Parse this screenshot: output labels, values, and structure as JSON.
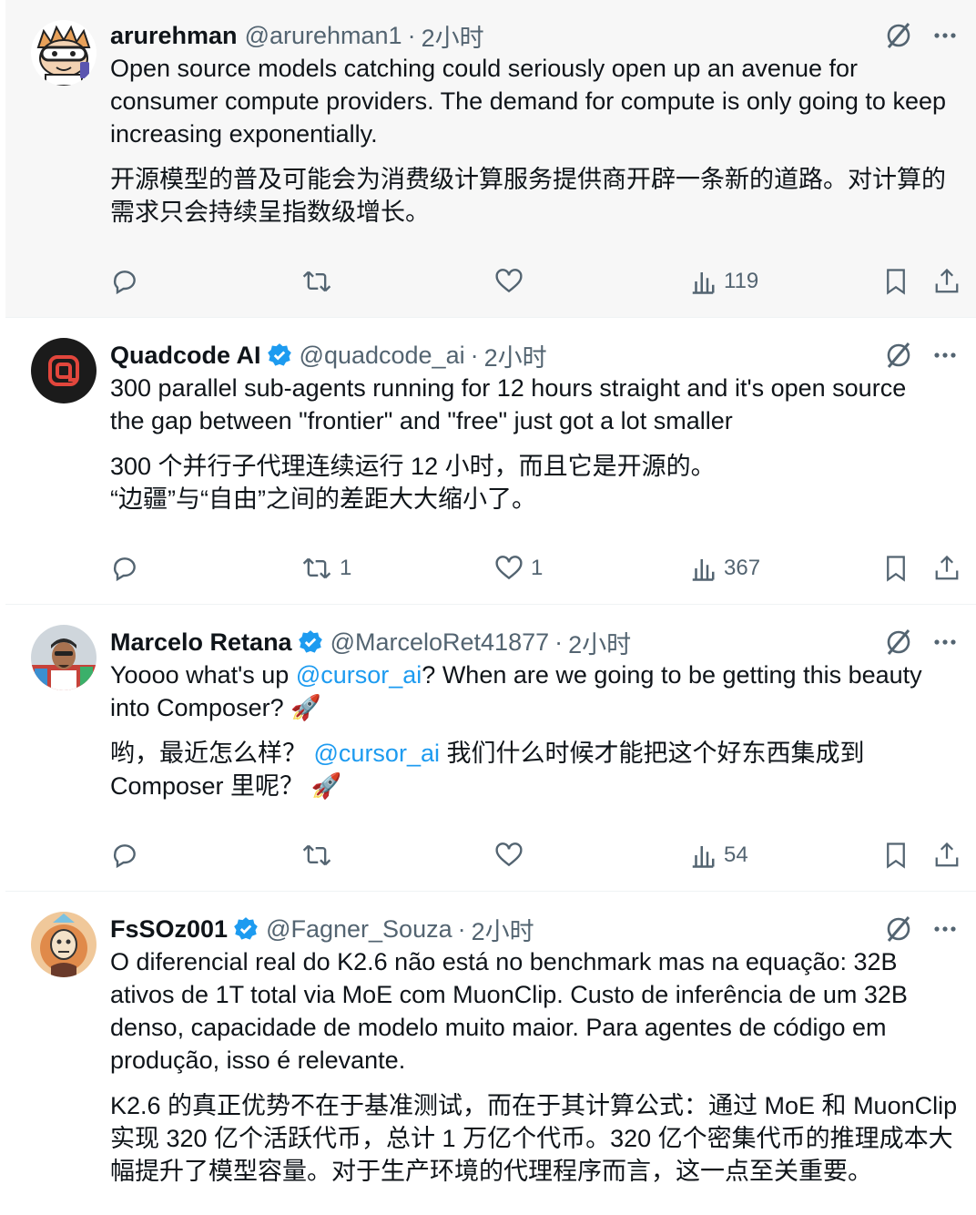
{
  "time_label": "2小时",
  "tweets": [
    {
      "name": "arurehman",
      "handle": "@arurehman1",
      "verified": false,
      "text": "Open source models catching could seriously open up an avenue for consumer compute providers. The demand for compute is only going to keep increasing exponentially.",
      "translation": "开源模型的普及可能会为消费级计算服务提供商开辟一条新的道路。对计算的需求只会持续呈指数级增长。",
      "replies": "",
      "retweets": "",
      "likes": "",
      "views": "119"
    },
    {
      "name": "Quadcode AI",
      "handle": "@quadcode_ai",
      "verified": true,
      "text": "300 parallel sub-agents running for 12 hours straight and it's open source\nthe gap between \"frontier\" and \"free\" just got a lot smaller",
      "translation": "300 个并行子代理连续运行 12 小时，而且它是开源的。\n“边疆”与“自由”之间的差距大大缩小了。",
      "replies": "",
      "retweets": "1",
      "likes": "1",
      "views": "367"
    },
    {
      "name": "Marcelo Retana",
      "handle": "@MarceloRet41877",
      "verified": true,
      "text_parts": [
        "Yoooo what's up ",
        "@cursor_ai",
        "? When are we going to be getting this beauty into Composer? 🚀"
      ],
      "translation_parts": [
        "哟，最近怎么样？ ",
        "@cursor_ai",
        " 我们什么时候才能把这个好东西集成到 Composer 里呢？ 🚀"
      ],
      "replies": "",
      "retweets": "",
      "likes": "",
      "views": "54"
    },
    {
      "name": "FsSOz001",
      "handle": "@Fagner_Souza",
      "verified": true,
      "text": "O diferencial real do K2.6 não está no benchmark mas na equação: 32B ativos de 1T total via MoE com MuonClip. Custo de inferência de um 32B denso, capacidade de modelo muito maior. Para agentes de código em produção, isso é relevante.",
      "translation": "K2.6 的真正优势不在于基准测试，而在于其计算公式：通过 MoE 和 MuonClip 实现 320 亿个活跃代币，总计 1 万亿个代币。320 亿个密集代币的推理成本大幅提升了模型容量。对于生产环境的代理程序而言，这一点至关重要。"
    }
  ],
  "colors": {
    "verified": "#1d9bf0",
    "mention": "#1d9bf0",
    "secondary_text": "#536471",
    "highlight_bg": "#f7f7f7"
  },
  "icons": [
    "grok-icon",
    "more-icon",
    "reply-icon",
    "retweet-icon",
    "like-icon",
    "views-icon",
    "bookmark-icon",
    "share-icon",
    "verified-icon"
  ]
}
